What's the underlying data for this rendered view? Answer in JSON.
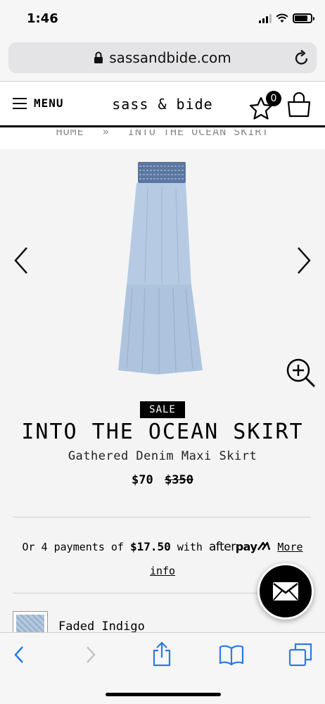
{
  "status_bar": {
    "time": "1:46",
    "icons": [
      "signal-icon",
      "wifi-icon",
      "battery-icon"
    ]
  },
  "browser": {
    "url": "sassandbide.com"
  },
  "header": {
    "menu_label": "MENU",
    "brand": "sass & bide",
    "wishlist_count": "0"
  },
  "breadcrumb": {
    "items": [
      "HOME",
      "»",
      "INTO THE OCEAN SKIRT"
    ]
  },
  "product": {
    "badge": "SALE",
    "title": "INTO THE OCEAN SKIRT",
    "subtitle": "Gathered Denim Maxi Skirt",
    "price_current": "$70",
    "price_original": "$350",
    "afterpay": {
      "prefix": "Or 4 payments of",
      "amount": "$17.50",
      "mid": "with",
      "logo_light": "after",
      "logo_bold": "pay",
      "more_info": "More info"
    },
    "color_name": "Faded Indigo"
  },
  "colors": {
    "accent": "#000000",
    "gallery_bg": "#f4f4f4",
    "ios_blue": "#2a7be4",
    "skirt": "#b6cbe3"
  }
}
